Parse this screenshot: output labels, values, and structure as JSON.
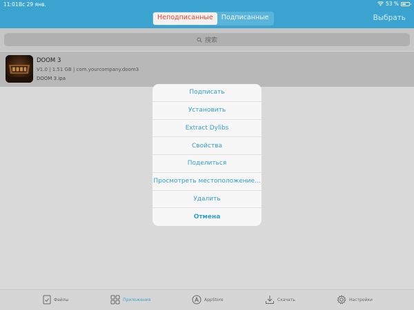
{
  "status_bar": {
    "time": "11:01",
    "date": "Вс 29 янв.",
    "battery": "53 %",
    "battery_level": 0.53
  },
  "nav": {
    "segments": [
      {
        "label": "Неподписанные",
        "active": true
      },
      {
        "label": "Подписанные",
        "active": false
      }
    ],
    "select_label": "Выбрать"
  },
  "search": {
    "placeholder": "搜索"
  },
  "apps": [
    {
      "name": "DOOM 3",
      "meta": "V1.0 | 1.51 GB | com.yourcompany.doom3",
      "file": "DOOM 3.ipa",
      "icon": "doom-app-icon"
    }
  ],
  "action_sheet": {
    "items": [
      "Подписать",
      "Установить",
      "Extract Dylibs",
      "Свойства",
      "Поделиться",
      "Просмотреть местоположение...",
      "Удалить",
      "Отмена"
    ]
  },
  "tabbar": {
    "tabs": [
      {
        "label": "Файлы",
        "icon": "folder-icon",
        "active": false
      },
      {
        "label": "Приложения",
        "icon": "apps-grid-icon",
        "active": true
      },
      {
        "label": "AppStore",
        "icon": "appstore-icon",
        "active": false
      },
      {
        "label": "Скачать",
        "icon": "download-icon",
        "active": false
      },
      {
        "label": "Настройки",
        "icon": "gear-icon",
        "active": false
      }
    ]
  },
  "colors": {
    "accent": "#3aa3cf",
    "active_segment_text": "#e0443a",
    "sheet_text": "#2f9ed0"
  }
}
